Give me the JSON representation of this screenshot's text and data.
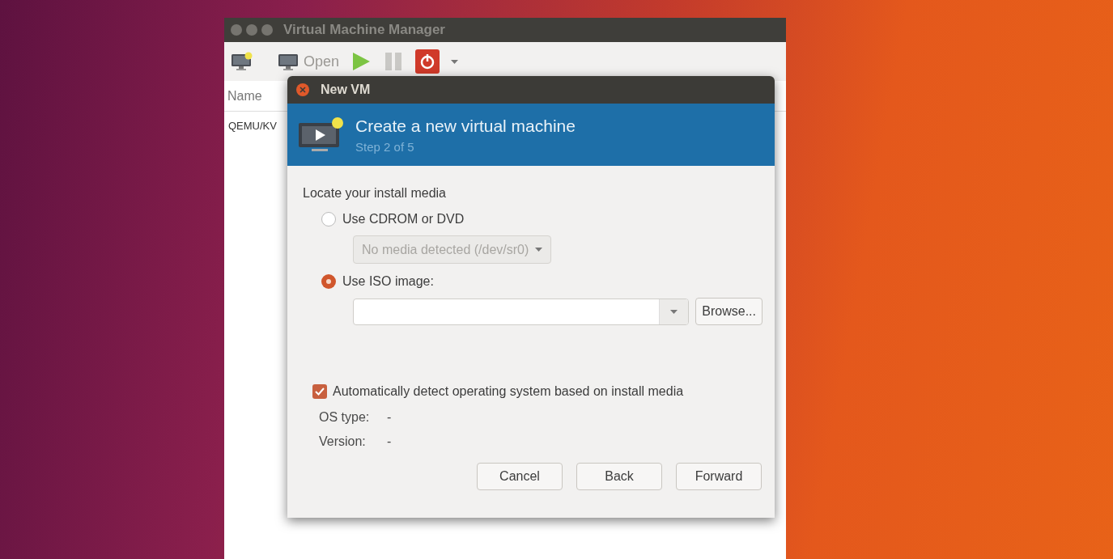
{
  "main_window": {
    "title": "Virtual Machine Manager",
    "toolbar": {
      "open_label": "Open"
    },
    "list_header": "Name",
    "rows": [
      "QEMU/KV"
    ]
  },
  "dialog": {
    "title": "New VM",
    "heading": "Create a new virtual machine",
    "step": "Step 2 of 5",
    "section_label": "Locate your install media",
    "options": [
      {
        "label": "Use CDROM or DVD",
        "selected": false,
        "field": {
          "kind": "dropdown",
          "value": "No media detected (/dev/sr0)",
          "disabled": true
        }
      },
      {
        "label": "Use ISO image:",
        "selected": true,
        "field": {
          "kind": "combo",
          "button": "Browse..."
        }
      }
    ],
    "auto_detect": {
      "label": "Automatically detect operating system based on install media",
      "checked": true
    },
    "details": [
      {
        "label": "OS type:",
        "value": "-"
      },
      {
        "label": "Version:",
        "value": "-"
      }
    ],
    "buttons": [
      "Cancel",
      "Back",
      "Forward"
    ]
  }
}
